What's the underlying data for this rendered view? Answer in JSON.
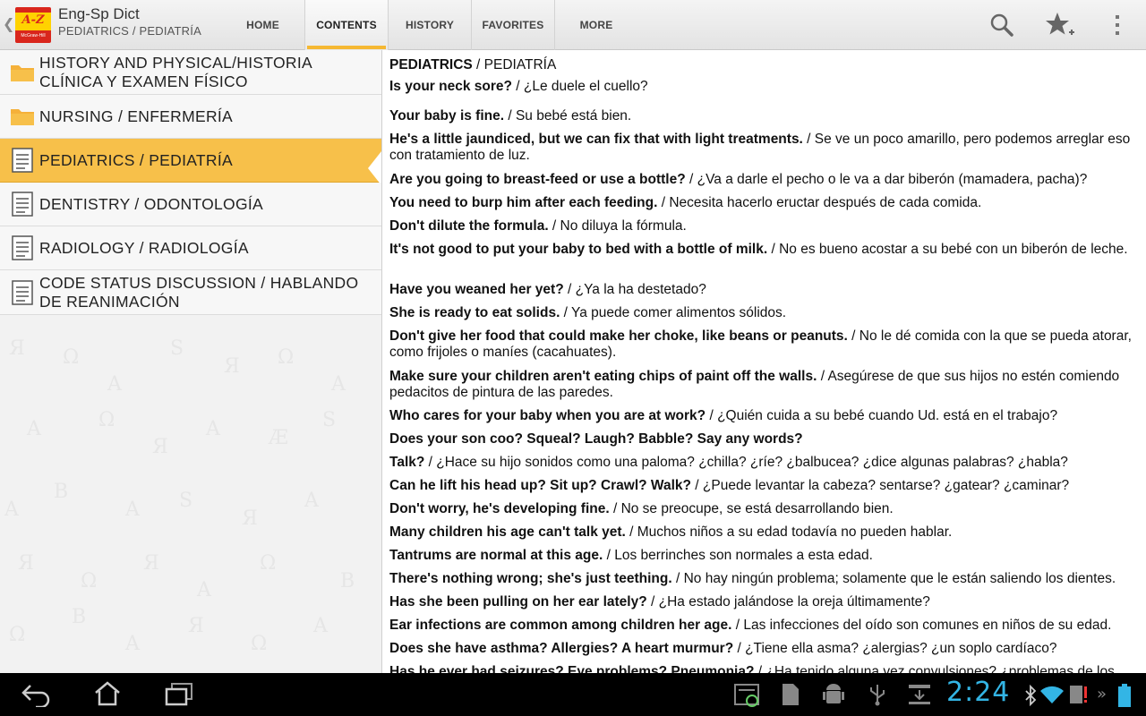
{
  "app": {
    "title": "Eng-Sp Dict",
    "subtitle": "PEDIATRICS / PEDIATRÍA",
    "logo_text": "A-Z",
    "logo_brand": "McGraw-Hill"
  },
  "tabs": [
    {
      "label": "HOME",
      "active": false
    },
    {
      "label": "CONTENTS",
      "active": true
    },
    {
      "label": "HISTORY",
      "active": false
    },
    {
      "label": "FAVORITES",
      "active": false
    },
    {
      "label": "MORE",
      "active": false
    }
  ],
  "actions": [
    "search-icon",
    "add-favorite-star-icon",
    "overflow-menu-icon"
  ],
  "sidebar": {
    "items": [
      {
        "label": "HISTORY AND PHYSICAL/HISTORIA CLÍNICA Y EXAMEN FÍSICO",
        "icon": "folder-icon"
      },
      {
        "label": "NURSING / ENFERMERÍA",
        "icon": "folder-icon"
      },
      {
        "label": "PEDIATRICS / PEDIATRÍA",
        "icon": "document-icon",
        "selected": true
      },
      {
        "label": "DENTISTRY / ODONTOLOGÍA",
        "icon": "document-icon"
      },
      {
        "label": "RADIOLOGY / RADIOLOGÍA",
        "icon": "document-icon"
      },
      {
        "label": "CODE STATUS DISCUSSION / HABLANDO DE REANIMACIÓN",
        "icon": "document-icon"
      }
    ]
  },
  "content": {
    "heading_en": "PEDIATRICS",
    "heading_sep": " / ",
    "heading_es": "PEDIATRÍA",
    "entries": [
      {
        "en": "Is your neck sore?",
        "es": "¿Le duele el cuello?"
      },
      {
        "en": "Your baby is fine.",
        "es": "Su bebé está bien."
      },
      {
        "en": "He's a little jaundiced, but we can fix that with light treatments.",
        "es": "Se ve un poco amarillo, pero podemos arreglar eso con tratamiento de luz."
      },
      {
        "en": "Are you going to breast-feed or use a bottle?",
        "es": "¿Va a darle el pecho o le va a dar biberón (mamadera, pacha)?"
      },
      {
        "en": "You need to burp him after each feeding.",
        "es": "Necesita hacerlo eructar después de cada comida."
      },
      {
        "en": "Don't dilute the formula.",
        "es": "No diluya la fórmula."
      },
      {
        "en": "It's not good to put your baby to bed with a bottle of milk.",
        "es": "No es bueno acostar a su bebé con un biberón de leche."
      },
      {
        "en": "Have you weaned her yet?",
        "es": "¿Ya la ha destetado?"
      },
      {
        "en": "She is ready to eat solids.",
        "es": "Ya puede comer alimentos sólidos."
      },
      {
        "en": "Don't give her food that could make her choke, like beans or peanuts.",
        "es": "No le dé comida con la que se pueda atorar, como frijoles o maníes (cacahuates)."
      },
      {
        "en": "Make sure your children aren't eating chips of paint off the walls.",
        "es": "Asegúrese de que sus hijos no estén comiendo pedacitos de pintura de las paredes."
      },
      {
        "en": "Who cares for your baby when you are at work?",
        "es": "¿Quién cuida a su bebé cuando Ud. está en el trabajo?"
      },
      {
        "en": "Does your son coo? Squeal? Laugh? Babble? Say any words?",
        "es": ""
      },
      {
        "en": "Talk?",
        "es": "¿Hace su hijo sonidos como una paloma? ¿chilla? ¿ríe? ¿balbucea? ¿dice algunas palabras? ¿habla?"
      },
      {
        "en": "Can he lift his head up? Sit up? Crawl? Walk?",
        "es": "¿Puede levantar la cabeza? sentarse? ¿gatear? ¿caminar?"
      },
      {
        "en": "Don't worry, he's developing fine.",
        "es": "No se preocupe, se está desarrollando bien."
      },
      {
        "en": "Many children his age can't talk yet.",
        "es": "Muchos niños a su edad todavía no pueden hablar."
      },
      {
        "en": "Tantrums are normal at this age.",
        "es": "Los berrinches son normales a esta edad."
      },
      {
        "en": "There's nothing wrong; she's just teething.",
        "es": "No hay ningún problema; solamente que le están saliendo los dientes."
      },
      {
        "en": "Has she been pulling on her ear lately?",
        "es": "¿Ha estado jalándose la oreja últimamente?"
      },
      {
        "en": "Ear infections are common among children her age.",
        "es": "Las infecciones del oído son comunes en niños de su edad."
      },
      {
        "en": "Does she have asthma? Allergies? A heart murmur?",
        "es": "¿Tiene ella asma? ¿alergias? ¿un soplo cardíaco?"
      },
      {
        "en": "Has he ever had seizures? Eye problems? Pneumonia?",
        "es": "¿Ha tenido alguna vez convulsiones? ¿problemas de los"
      }
    ],
    "separator": " / "
  },
  "navbar": {
    "clock": "2:24"
  },
  "colors": {
    "selected_bg": "#f7c04a",
    "tab_indicator": "#f5b833",
    "clock": "#33b5e5"
  }
}
